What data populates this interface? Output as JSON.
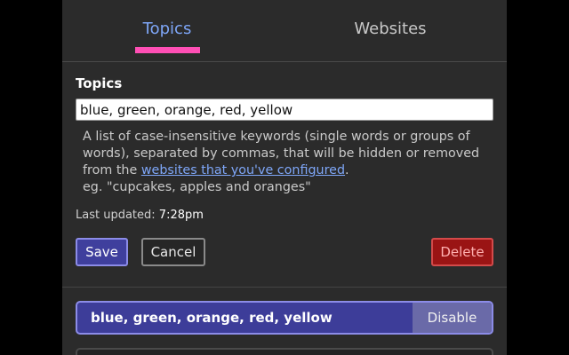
{
  "tabs": [
    {
      "label": "Topics",
      "active": true
    },
    {
      "label": "Websites",
      "active": false
    }
  ],
  "editor": {
    "title": "Topics",
    "input_value": "blue, green, orange, red, yellow",
    "help_text_before": "A list of case-insensitive keywords (single words or groups of words), separated by commas, that will be hidden or removed from the ",
    "help_link": "websites that you've configured",
    "help_text_after": ".",
    "help_example": "eg. \"cupcakes, apples and oranges\"",
    "last_updated_label": "Last updated:",
    "last_updated_time": "7:28pm",
    "save_label": "Save",
    "cancel_label": "Cancel",
    "delete_label": "Delete"
  },
  "topic_list": [
    {
      "label": "blue, green, orange, red, yellow",
      "action": "Disable"
    }
  ],
  "colors": {
    "accent": "#7ea6f7",
    "tab_underline": "#ff4fb5",
    "primary": "#3f3f9d",
    "danger": "#9a1414",
    "background": "#2b2b2b"
  }
}
